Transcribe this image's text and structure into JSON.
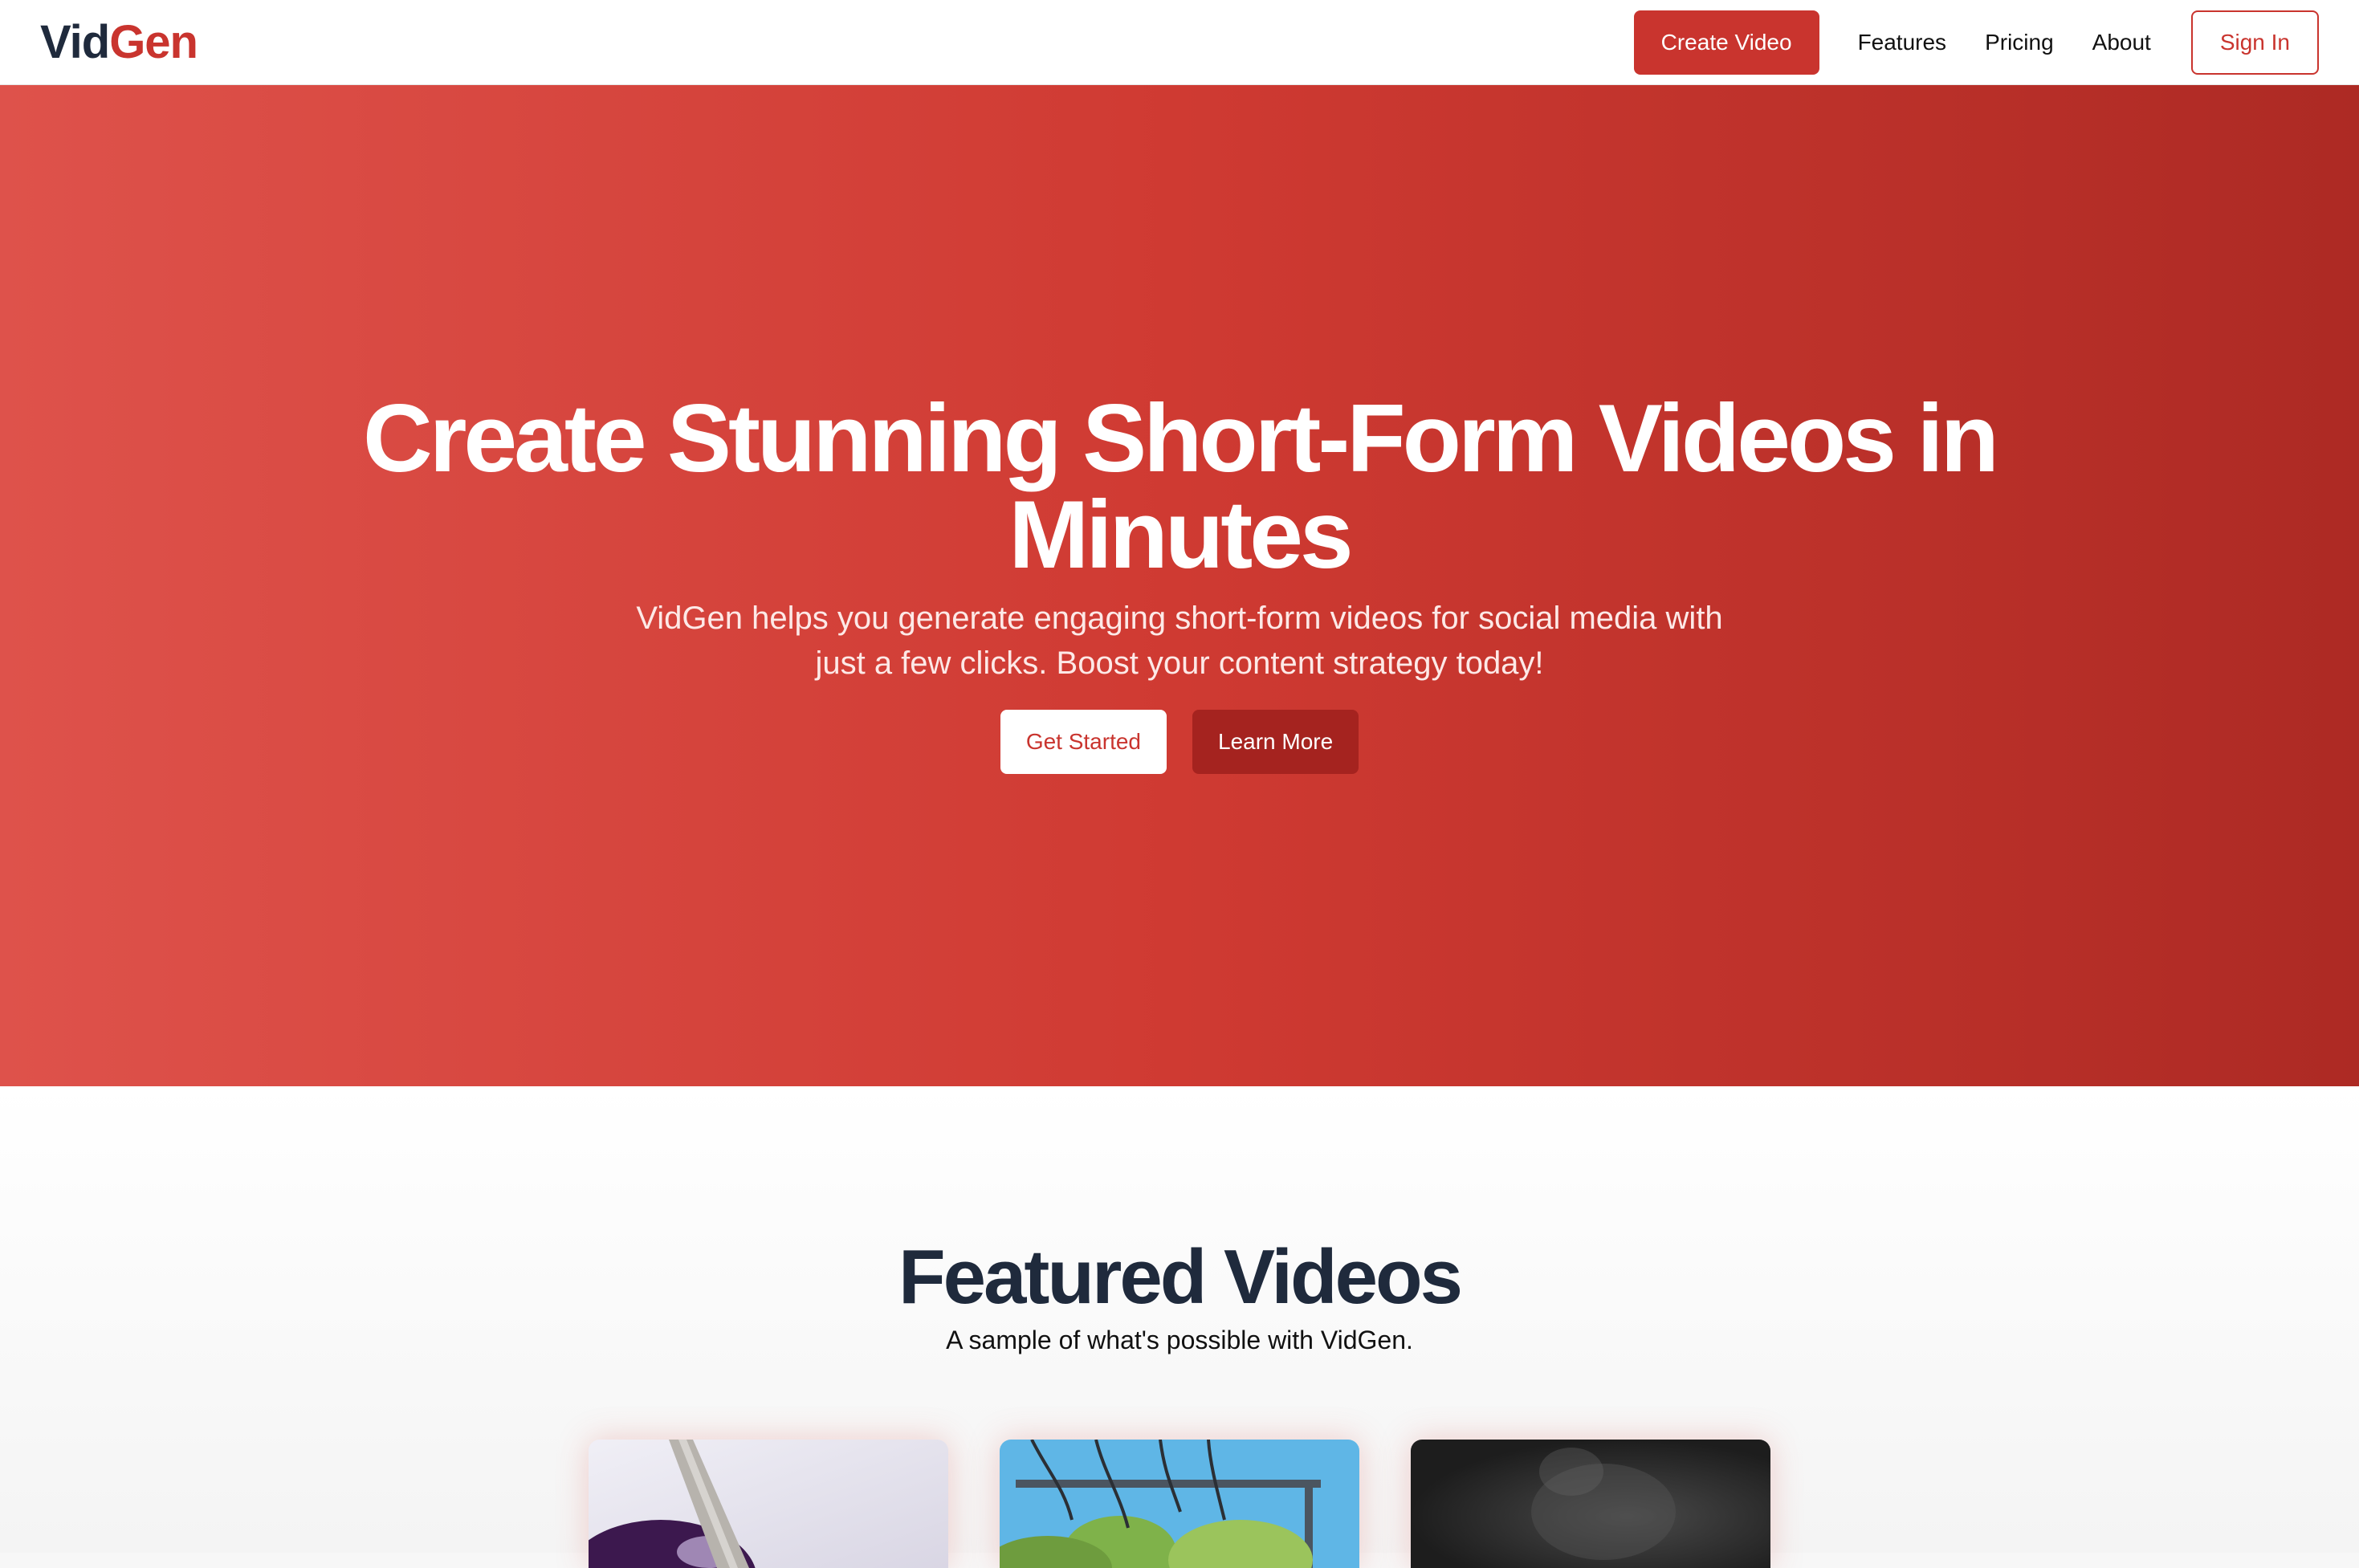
{
  "navbar": {
    "logo_part1": "Vid",
    "logo_part2": "Gen",
    "create_video_label": "Create Video",
    "links": [
      "Features",
      "Pricing",
      "About"
    ],
    "sign_in_label": "Sign In"
  },
  "hero": {
    "title": "Create Stunning Short-Form Videos in Minutes",
    "subtitle": "VidGen helps you generate engaging short-form videos for social media with just a few clicks. Boost your content strategy today!",
    "primary_button": "Get Started",
    "secondary_button": "Learn More"
  },
  "featured": {
    "title": "Featured Videos",
    "subtitle": "A sample of what's possible with VidGen.",
    "cards": [
      {
        "thumbnail": "purple-bowl-thumbnail"
      },
      {
        "thumbnail": "cartoon-landscape-thumbnail"
      },
      {
        "thumbnail": "dark-smoke-thumbnail"
      }
    ]
  },
  "colors": {
    "brand_red": "#c9342e",
    "navy": "#1f2a3c",
    "hero_gradient_start": "#de524b",
    "hero_gradient_end": "#ad2a24",
    "learn_more_bg": "#a5231f"
  }
}
